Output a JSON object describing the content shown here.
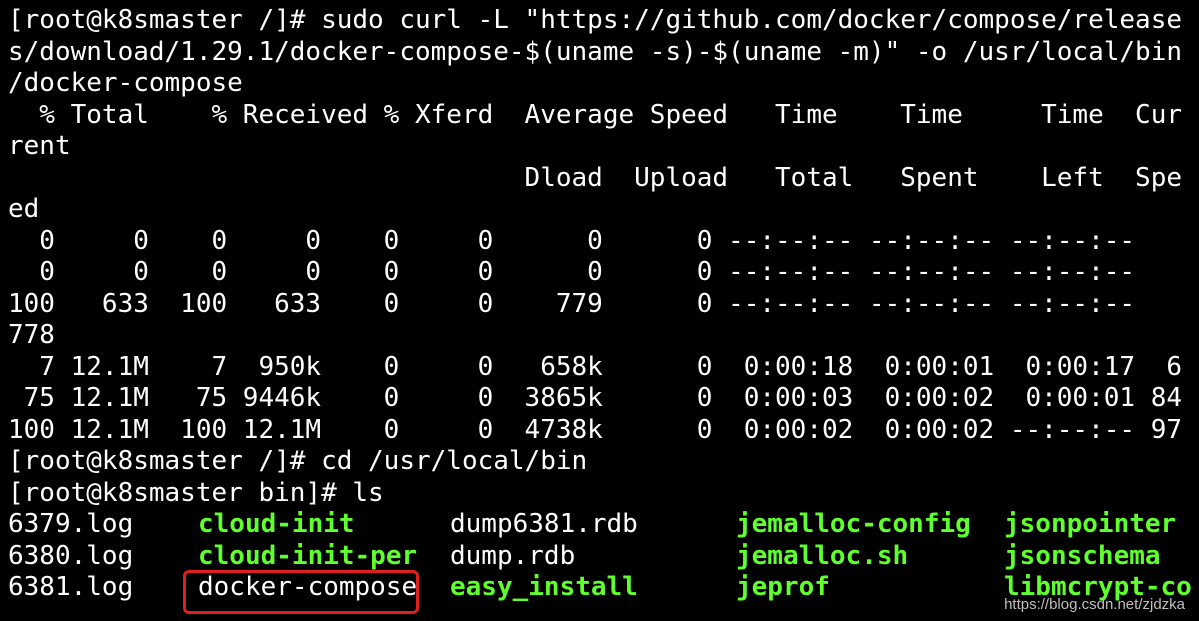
{
  "terminal": {
    "lines": [
      "[root@k8smaster /]# sudo curl -L \"https://github.com/docker/compose/release",
      "s/download/1.29.1/docker-compose-$(uname -s)-$(uname -m)\" -o /usr/local/bin",
      "/docker-compose",
      "  % Total    % Received % Xferd  Average Speed   Time    Time     Time  Cur",
      "rent",
      "                                 Dload  Upload   Total   Spent    Left  Spe",
      "ed",
      "  0     0    0     0    0     0      0      0 --:--:-- --:--:-- --:--:--",
      "  0     0    0     0    0     0      0      0 --:--:-- --:--:-- --:--:--",
      "100   633  100   633    0     0    779      0 --:--:-- --:--:-- --:--:--",
      "778",
      "  7 12.1M    7  950k    0     0   658k      0  0:00:18  0:00:01  0:00:17  6",
      " 75 12.1M   75 9446k    0     0  3865k      0  0:00:03  0:00:02  0:00:01 84",
      "100 12.1M  100 12.1M    0     0  4738k      0  0:00:02  0:00:02 --:--:-- 97",
      "[root@k8smaster /]# cd /usr/local/bin",
      "[root@k8smaster bin]# ls"
    ],
    "ls_rows": [
      [
        "6379.log",
        "cloud-init",
        "dump6381.rdb",
        "jemalloc-config",
        "jsonpointer"
      ],
      [
        "6380.log",
        "cloud-init-per",
        "dump.rdb",
        "jemalloc.sh",
        "jsonschema"
      ],
      [
        "6381.log",
        "docker-compose",
        "easy_install",
        "jeprof",
        "libmcrypt-co"
      ]
    ],
    "green_color": "#5fff2e",
    "highlight_color": "#e02020"
  },
  "watermark": "https://blog.csdn.net/zjdzka"
}
